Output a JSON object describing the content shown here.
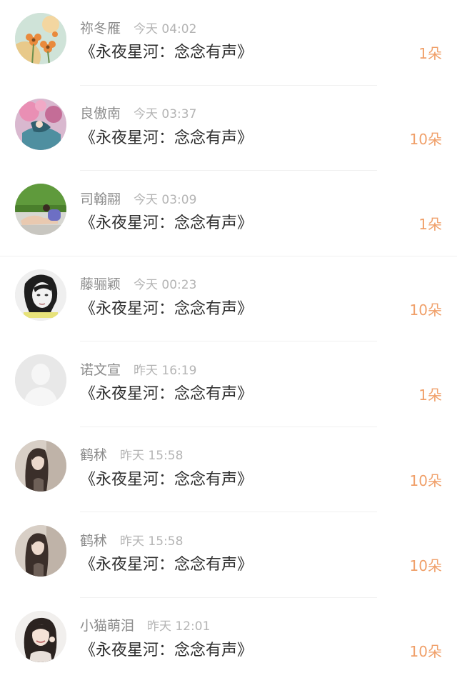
{
  "colors": {
    "name": "#8c8c8c",
    "time": "#b4b4b4",
    "title": "#2e2e2e",
    "amount": "#f0a06a",
    "divider": "#f0f0f0"
  },
  "items": [
    {
      "name": "祢冬雁",
      "time": "今天 04:02",
      "title": "《永夜星河：念念有声》",
      "amount": "1朵",
      "avatar": "flowers"
    },
    {
      "name": "良傲南",
      "time": "今天 03:37",
      "title": "《永夜星河：念念有声》",
      "amount": "10朵",
      "avatar": "painting"
    },
    {
      "name": "司翰翮",
      "time": "今天 03:09",
      "title": "《永夜星河：念念有声》",
      "amount": "1朵",
      "avatar": "stretch"
    },
    {
      "name": "藤骊颖",
      "time": "今天 00:23",
      "title": "《永夜星河：念念有声》",
      "amount": "10朵",
      "avatar": "bw-portrait"
    },
    {
      "name": "诺文宣",
      "time": "昨天 16:19",
      "title": "《永夜星河：念念有声》",
      "amount": "1朵",
      "avatar": "default"
    },
    {
      "name": "鹤秫",
      "time": "昨天 15:58",
      "title": "《永夜星河：念念有声》",
      "amount": "10朵",
      "avatar": "girl-long-hair"
    },
    {
      "name": "鹤秫",
      "time": "昨天 15:58",
      "title": "《永夜星河：念念有声》",
      "amount": "10朵",
      "avatar": "girl-long-hair"
    },
    {
      "name": "小猫萌泪",
      "time": "昨天 12:01",
      "title": "《永夜星河：念念有声》",
      "amount": "10朵",
      "avatar": "girl-smile"
    }
  ]
}
